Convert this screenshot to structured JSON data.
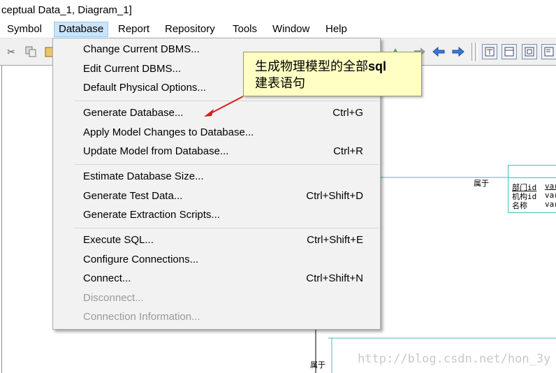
{
  "window": {
    "title": "ceptual Data_1, Diagram_1]"
  },
  "menubar": [
    "Symbol",
    "Database",
    "Report",
    "Repository",
    "Tools",
    "Window",
    "Help"
  ],
  "database_menu": {
    "groups": [
      [
        {
          "label": "Change Current DBMS...",
          "shortcut": ""
        },
        {
          "label": "Edit Current DBMS...",
          "shortcut": ""
        },
        {
          "label": "Default Physical Options...",
          "shortcut": ""
        }
      ],
      [
        {
          "label": "Generate Database...",
          "shortcut": "Ctrl+G"
        },
        {
          "label": "Apply Model Changes to Database...",
          "shortcut": ""
        },
        {
          "label": "Update Model from Database...",
          "shortcut": "Ctrl+R"
        }
      ],
      [
        {
          "label": "Estimate Database Size...",
          "shortcut": ""
        },
        {
          "label": "Generate Test Data...",
          "shortcut": "Ctrl+Shift+D"
        },
        {
          "label": "Generate Extraction Scripts...",
          "shortcut": ""
        }
      ],
      [
        {
          "label": "Execute SQL...",
          "shortcut": "Ctrl+Shift+E"
        },
        {
          "label": "Configure Connections...",
          "shortcut": ""
        },
        {
          "label": "Connect...",
          "shortcut": "Ctrl+Shift+N"
        },
        {
          "label": "Disconnect...",
          "shortcut": "",
          "disabled": true
        },
        {
          "label": "Connection Information...",
          "shortcut": "",
          "disabled": true
        }
      ]
    ]
  },
  "callout": {
    "line1": "生成物理模型的全部",
    "line1_bold": "sql",
    "line2": "建表语句"
  },
  "diagram": {
    "relation_label_1": "属于",
    "relation_label_2": "属于",
    "entity_rows": [
      {
        "name": "部门id",
        "type": "var"
      },
      {
        "name": "机构id",
        "type": "var"
      },
      {
        "name": "名称",
        "type": "var"
      }
    ]
  },
  "watermark": "http://blog.csdn.net/hon_3y",
  "colors": {
    "menu_highlight": "#cce4f7",
    "callout_bg": "#ffffc4",
    "arrow": "#d81e1e",
    "entity_border": "#3cc0c0"
  }
}
